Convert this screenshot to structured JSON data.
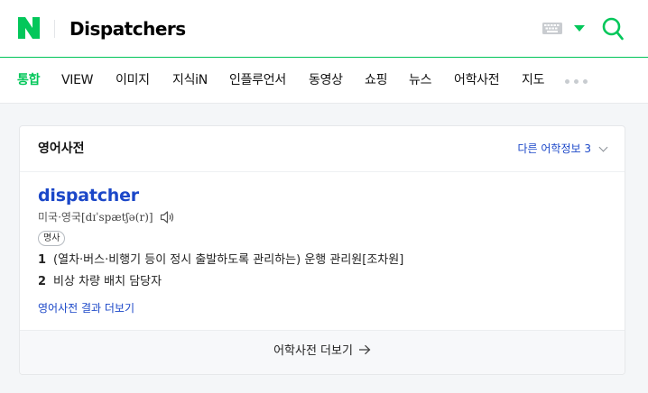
{
  "header": {
    "logo": "N",
    "query": "Dispatchers",
    "icons": {
      "keyboard": "keyboard-icon",
      "dropdown": "caret-down-icon",
      "search": "search-icon"
    },
    "colors": {
      "brand": "#03c75a"
    }
  },
  "tabs": {
    "items": [
      {
        "label": "통합",
        "active": true
      },
      {
        "label": "VIEW"
      },
      {
        "label": "이미지"
      },
      {
        "label": "지식iN"
      },
      {
        "label": "인플루언서"
      },
      {
        "label": "동영상"
      },
      {
        "label": "쇼핑"
      },
      {
        "label": "뉴스"
      },
      {
        "label": "어학사전"
      },
      {
        "label": "지도"
      }
    ],
    "more_icon": "more-dots-icon"
  },
  "dictionary": {
    "title": "영어사전",
    "other_info": "다른 어학정보 3",
    "word": "dispatcher",
    "pronunciation_label": "미국·영국",
    "ipa": "[dɪˈspætʃə(r)]",
    "part_of_speech": "명사",
    "definitions": [
      {
        "num": "1",
        "text": "(열차·버스·비행기 등이 정시 출발하도록 관리하는) 운행 관리원[조차원]"
      },
      {
        "num": "2",
        "text": "비상 차량 배치 담당자"
      }
    ],
    "more_results": "영어사전 결과 더보기",
    "footer_more": "어학사전 더보기",
    "colors": {
      "link": "#1b47c8"
    }
  }
}
